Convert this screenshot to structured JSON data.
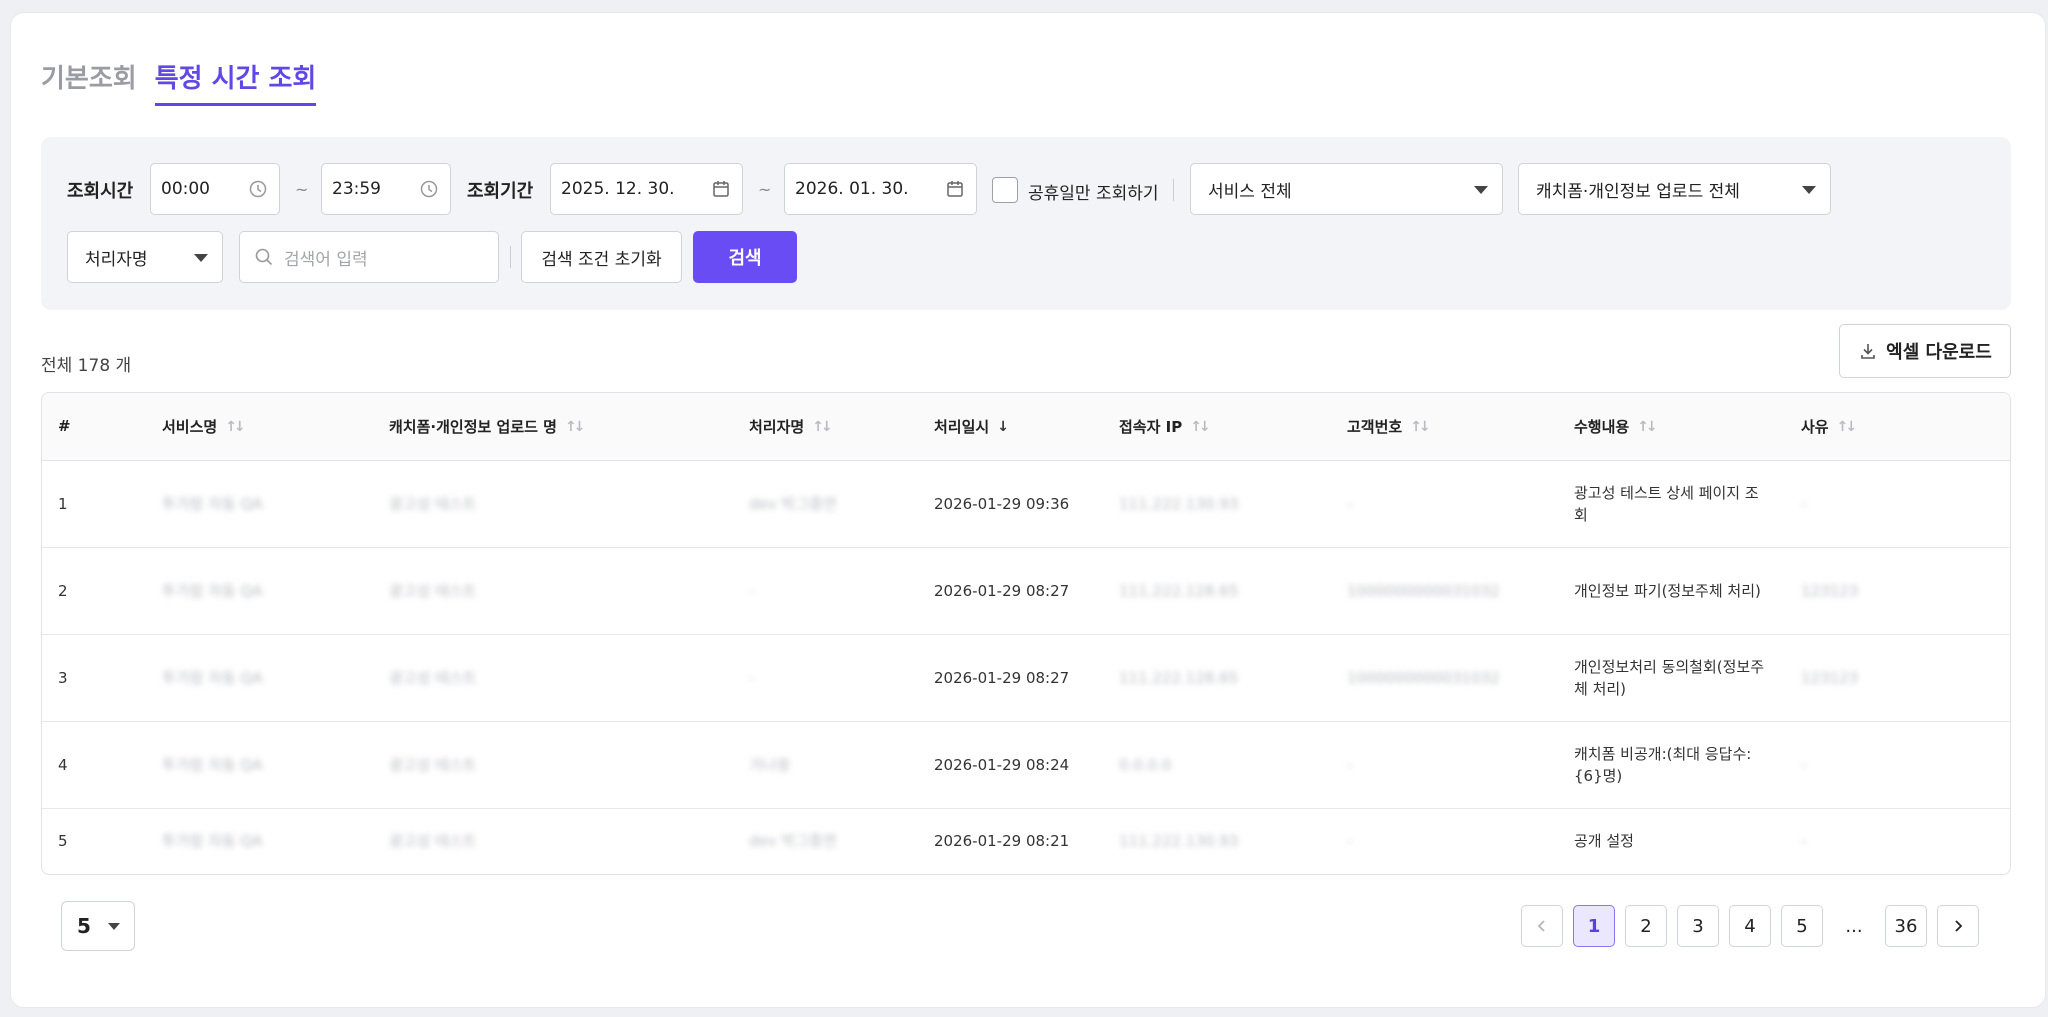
{
  "tabs": [
    {
      "label": "기본조회",
      "active": false
    },
    {
      "label": "특정 시간 조회",
      "active": true
    }
  ],
  "filters": {
    "time_label": "조회시간",
    "time_start": "00:00",
    "time_end": "23:59",
    "tilde": "~",
    "period_label": "조회기간",
    "date_start": "2025. 12. 30.",
    "date_end": "2026. 01. 30.",
    "holiday_checkbox_label": "공휴일만 조회하기",
    "service_select": "서비스 전체",
    "upload_select": "캐치폼·개인정보 업로드 전체",
    "search_field_select": "처리자명",
    "search_placeholder": "검색어 입력",
    "reset_button": "검색 조건 초기화",
    "search_button": "검색"
  },
  "summary": {
    "total_text": "전체 178 개",
    "excel_button": "엑셀 다운로드"
  },
  "table": {
    "columns": [
      "#",
      "서비스명",
      "캐치폼·개인정보 업로드 명",
      "처리자명",
      "처리일시",
      "접속자 IP",
      "고객번호",
      "수행내용",
      "사유"
    ],
    "rows": [
      {
        "no": "1",
        "service": "투가람 자동 QA",
        "upload_name": "광고성 테스트",
        "handler": "dev 박그중연",
        "datetime": "2026-01-29 09:36",
        "ip": "111.222.130.93",
        "customer_no": "-",
        "action": "광고성 테스트 상세 페이지 조회",
        "reason": "-"
      },
      {
        "no": "2",
        "service": "투가람 자동 QA",
        "upload_name": "광고성 테스트",
        "handler": "-",
        "datetime": "2026-01-29 08:27",
        "ip": "111.222.128.65",
        "customer_no": "1000000000031032",
        "action": "개인정보 파기(정보주체 처리)",
        "reason": "123123"
      },
      {
        "no": "3",
        "service": "투가람 자동 QA",
        "upload_name": "광고성 테스트",
        "handler": "-",
        "datetime": "2026-01-29 08:27",
        "ip": "111.222.128.65",
        "customer_no": "1000000000031032",
        "action": "개인정보처리 동의철회(정보주체 처리)",
        "reason": "123123"
      },
      {
        "no": "4",
        "service": "투가람 자동 QA",
        "upload_name": "광고성 테스트",
        "handler": "가나웅",
        "datetime": "2026-01-29 08:24",
        "ip": "0.0.0.0",
        "customer_no": "-",
        "action": "캐치폼 비공개:(최대 응답수: {6}명)",
        "reason": "-"
      },
      {
        "no": "5",
        "service": "투가람 자동 QA",
        "upload_name": "광고성 테스트",
        "handler": "dev 박그중연",
        "datetime": "2026-01-29 08:21",
        "ip": "111.222.130.93",
        "customer_no": "-",
        "action": "공개 설정",
        "reason": "-"
      }
    ]
  },
  "pagination": {
    "page_size": "5",
    "pages": [
      "1",
      "2",
      "3",
      "4",
      "5",
      "...",
      "36"
    ],
    "current": "1"
  }
}
